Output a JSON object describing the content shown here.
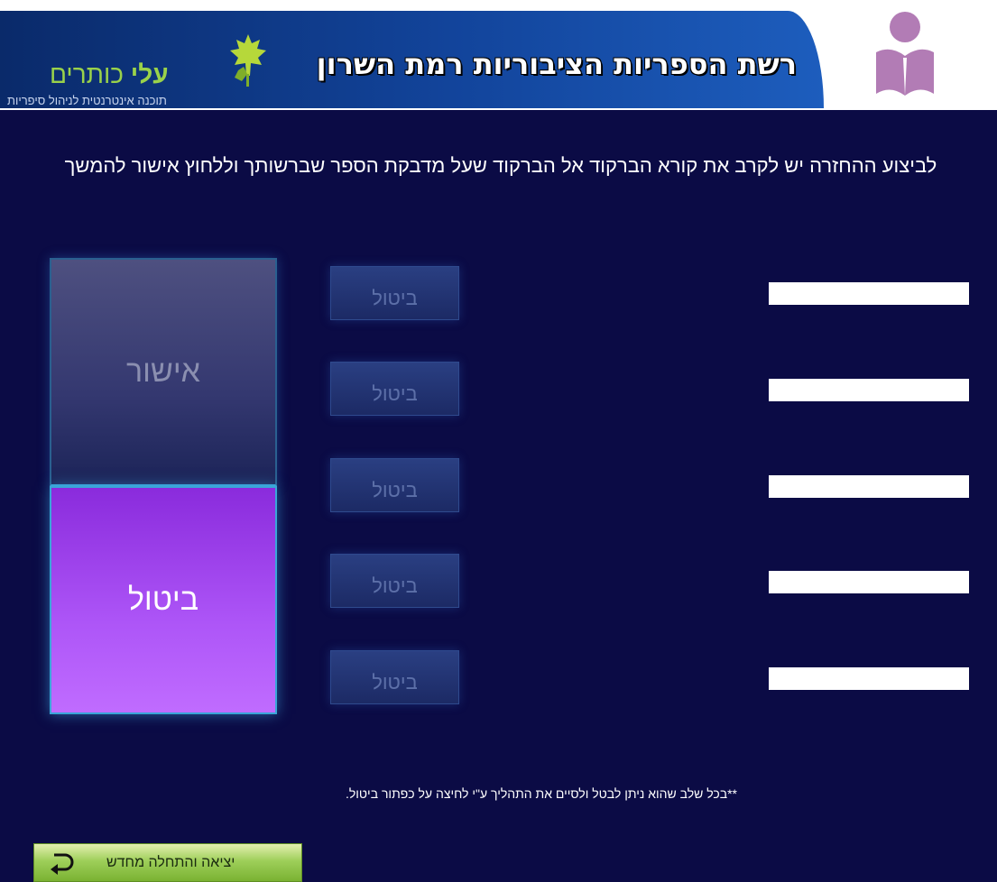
{
  "header": {
    "title": "רשת הספריות הציבוריות רמת השרון",
    "logo_name_part1": "עלי",
    "logo_name_part2": "כותרים",
    "logo_tagline": "תוכנה אינטרנטית לניהול סיפריות"
  },
  "instruction": "לביצוע ההחזרה יש לקרב את קורא הברקוד אל הברקוד שעל מדבקת הספר שברשותך וללחוץ אישור להמשך",
  "actions": {
    "approve_label": "אישור",
    "cancel_label": "ביטול"
  },
  "rows": [
    {
      "cancel_label": "ביטול",
      "barcode_value": ""
    },
    {
      "cancel_label": "ביטול",
      "barcode_value": ""
    },
    {
      "cancel_label": "ביטול",
      "barcode_value": ""
    },
    {
      "cancel_label": "ביטול",
      "barcode_value": ""
    },
    {
      "cancel_label": "ביטול",
      "barcode_value": ""
    }
  ],
  "note": "**בכל שלב שהוא ניתן לבטל ולסיים את התהליך ע\"י לחיצה על כפתור ביטול.",
  "footer": {
    "exit_label": "יציאה והתחלה מחדש"
  },
  "colors": {
    "background": "#0b0b45",
    "banner": "#12449b",
    "cancel_active": "#ad55f7",
    "logo_green": "#9ad24a",
    "exit_button": "#9ecf5a"
  },
  "icons": {
    "logo": "leaf-icon",
    "header_right": "book-reader-icon",
    "exit": "return-arrow-icon"
  }
}
